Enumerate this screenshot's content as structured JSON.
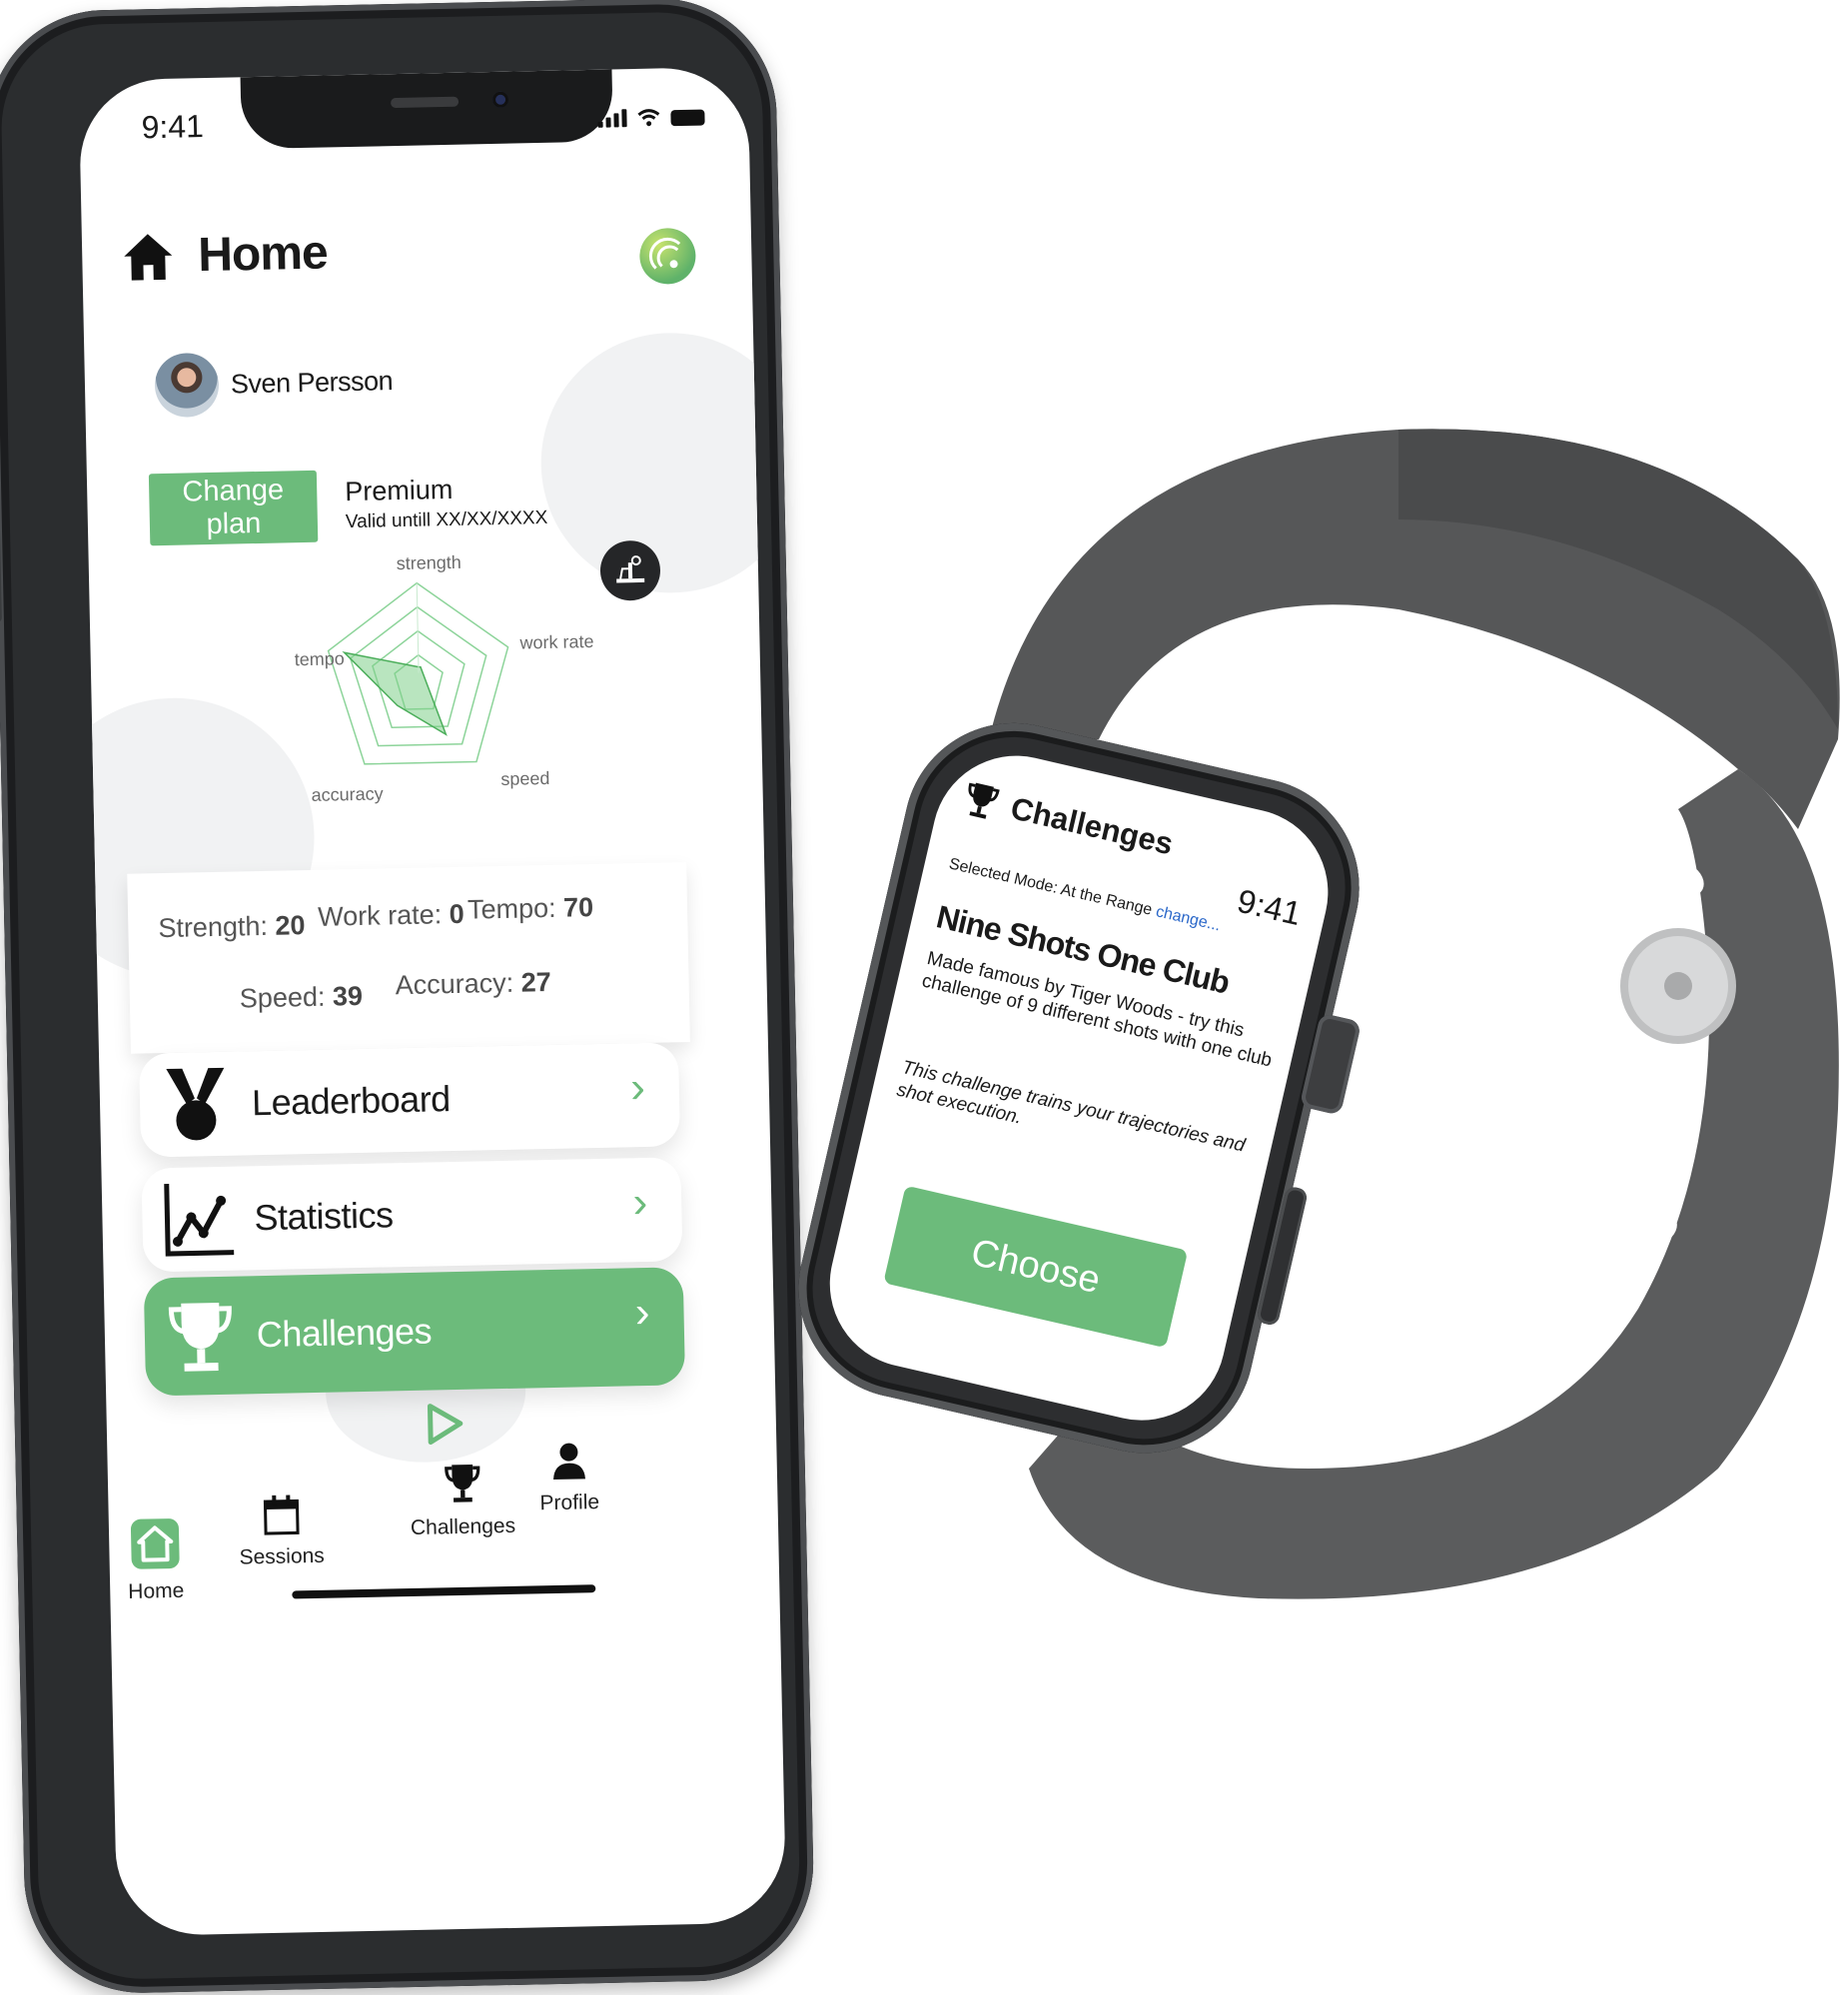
{
  "colors": {
    "accent": "#6cbb7b",
    "phone_frame": "#2b2d2f",
    "watch_band": "#575859",
    "link": "#2a67c9"
  },
  "phone": {
    "status": {
      "time": "9:41"
    },
    "header": {
      "title": "Home",
      "icon": "home-icon",
      "logo": "golf-logo-icon"
    },
    "user": {
      "name": "Sven Persson"
    },
    "plan": {
      "button_label": "Change plan",
      "name": "Premium",
      "valid": "Valid untill XX/XX/XXXX"
    },
    "radar": {
      "labels": [
        "strength",
        "work rate",
        "speed",
        "accuracy",
        "tempo"
      ]
    },
    "stats": {
      "strength_label": "Strength:",
      "strength_value": "20",
      "workrate_label": "Work rate:",
      "workrate_value": "0",
      "tempo_label": "Tempo:",
      "tempo_value": "70",
      "speed_label": "Speed:",
      "speed_value": "39",
      "accuracy_label": "Accuracy:",
      "accuracy_value": "27"
    },
    "menu": [
      {
        "label": "Leaderboard",
        "icon": "medal-icon"
      },
      {
        "label": "Statistics",
        "icon": "chart-icon"
      },
      {
        "label": "Challenges",
        "icon": "trophy-icon"
      }
    ],
    "tabs": [
      {
        "label": "Home",
        "icon": "home-icon"
      },
      {
        "label": "Sessions",
        "icon": "calendar-icon"
      },
      {
        "label": "Challenges",
        "icon": "trophy-icon"
      },
      {
        "label": "Profile",
        "icon": "user-icon"
      }
    ]
  },
  "watch": {
    "title": "Challenges",
    "time": "9:41",
    "mode_label": "Selected Mode: At the Range",
    "mode_link": "change...",
    "challenge_title": "Nine Shots One Club",
    "description": "Made famous by Tiger Woods - try this challenge of 9 different shots with one club",
    "note": "This challenge trains your trajectories and shot execution.",
    "button_label": "Choose"
  }
}
